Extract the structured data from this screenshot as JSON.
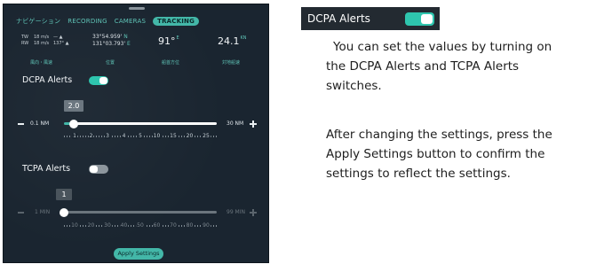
{
  "tabs": [
    {
      "label": "ナビゲーション",
      "active": false
    },
    {
      "label": "RECORDING",
      "active": false
    },
    {
      "label": "CAMERAS",
      "active": false
    },
    {
      "label": "TRACKING",
      "active": true
    }
  ],
  "nav": {
    "tw_label": "TW",
    "tw_speed": "18 m/s",
    "tw_arrow": "— ▲",
    "rw_label": "RW",
    "rw_speed": "18 m/s",
    "rw_arrow": "137° ▲",
    "lat": "33°54.959'",
    "lat_hem": "N",
    "lon": "131°03.793'",
    "lon_hem": "E",
    "heading": "91°",
    "heading_unit": "E",
    "sog": "24.1",
    "sog_unit": "KN",
    "labels": [
      "風向・風速",
      "位置",
      "船首方位",
      "対地船速"
    ]
  },
  "dcpa": {
    "label": "DCPA Alerts",
    "enabled": true,
    "value": "2.0",
    "min": "0.1 NM",
    "max": "30 NM",
    "fraction": 0.064,
    "scale": [
      "1",
      "2",
      "3",
      "4",
      "5",
      "10",
      "15",
      "20",
      "25"
    ]
  },
  "tcpa": {
    "label": "TCPA Alerts",
    "enabled": false,
    "value": "1",
    "min": "1 MIN",
    "max": "99 MIN",
    "fraction": 0.0,
    "scale": [
      "10",
      "20",
      "30",
      "40",
      "50",
      "60",
      "70",
      "80",
      "90"
    ]
  },
  "apply_label": "Apply Settings",
  "explanation": {
    "title": "DCPA Alerts",
    "p1": [
      "You can set the values by turning on",
      "the DCPA Alerts and TCPA Alerts",
      "switches."
    ],
    "p2": [
      "After changing the settings, press the",
      "Apply Settings button to confirm the",
      "settings to reflect the settings."
    ]
  },
  "colors": {
    "accent": "#43b7a8",
    "panel_bg": "#1a2530",
    "toggle_on": "#2ec5ae",
    "toggle_off": "#8d969d"
  }
}
